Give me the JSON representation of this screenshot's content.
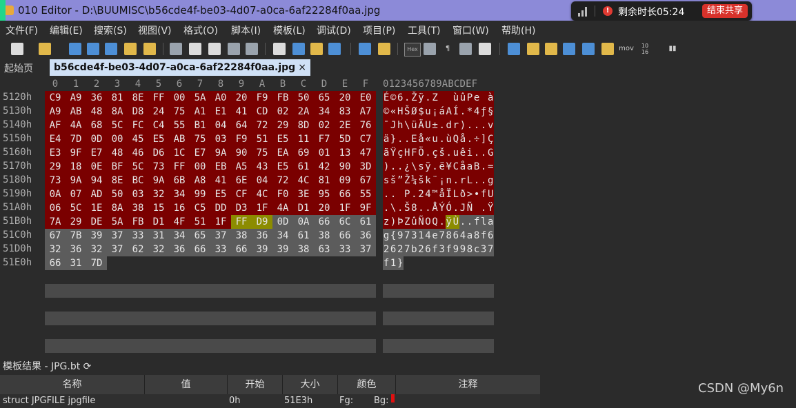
{
  "window": {
    "title": "010 Editor - D:\\BUUMISC\\b56cde4f-be03-4d07-a0ca-6af22284f0aa.jpg"
  },
  "share_widget": {
    "remaining": "剩余时长05:24",
    "end_button": "结束共享"
  },
  "menu": [
    "文件(F)",
    "编辑(E)",
    "搜索(S)",
    "视图(V)",
    "格式(O)",
    "脚本(I)",
    "模板(L)",
    "调试(D)",
    "项目(P)",
    "工具(T)",
    "窗口(W)",
    "帮助(H)"
  ],
  "toolbar": {
    "hex_label": "Hex",
    "mov_label": "mov",
    "base_label": "10 16"
  },
  "tabs": {
    "start": "起始页",
    "file": "b56cde4f-be03-4d07-a0ca-6af22284f0aa.jpg",
    "close": "×"
  },
  "hex": {
    "columns": [
      "0",
      "1",
      "2",
      "3",
      "4",
      "5",
      "6",
      "7",
      "8",
      "9",
      "A",
      "B",
      "C",
      "D",
      "E",
      "F"
    ],
    "ascii_header": "0123456789ABCDEF",
    "rows": [
      {
        "addr": "5120h",
        "bytes": [
          "C9",
          "A9",
          "36",
          "81",
          "8E",
          "FF",
          "00",
          "5A",
          "A0",
          "20",
          "F9",
          "FB",
          "50",
          "65",
          "20",
          "E0"
        ],
        "ascii": "É©6.Žÿ.Z  ùûPe à"
      },
      {
        "addr": "5130h",
        "bytes": [
          "A9",
          "AB",
          "48",
          "8A",
          "D8",
          "24",
          "75",
          "A1",
          "E1",
          "41",
          "CD",
          "02",
          "2A",
          "34",
          "83",
          "A7"
        ],
        "ascii": "©«HŠØ$u¡áAÍ.*4ƒ§"
      },
      {
        "addr": "5140h",
        "bytes": [
          "AF",
          "4A",
          "68",
          "5C",
          "FC",
          "C4",
          "55",
          "B1",
          "04",
          "64",
          "72",
          "29",
          "8D",
          "02",
          "2E",
          "76"
        ],
        "ascii": "¯Jh\\üÄU±.dr)...v"
      },
      {
        "addr": "5150h",
        "bytes": [
          "E4",
          "7D",
          "0D",
          "00",
          "45",
          "E5",
          "AB",
          "75",
          "03",
          "F9",
          "51",
          "E5",
          "11",
          "F7",
          "5D",
          "C7"
        ],
        "ascii": "ä}..Eå«u.ùQå.÷]Ç"
      },
      {
        "addr": "5160h",
        "bytes": [
          "E3",
          "9F",
          "E7",
          "48",
          "46",
          "D6",
          "1C",
          "E7",
          "9A",
          "90",
          "75",
          "EA",
          "69",
          "01",
          "13",
          "47"
        ],
        "ascii": "ãŸçHFÖ.çš.uêi..G"
      },
      {
        "addr": "5170h",
        "bytes": [
          "29",
          "18",
          "0E",
          "BF",
          "5C",
          "73",
          "FF",
          "00",
          "EB",
          "A5",
          "43",
          "E5",
          "61",
          "42",
          "90",
          "3D"
        ],
        "ascii": ")..¿\\sÿ.ë¥CåaB.="
      },
      {
        "addr": "5180h",
        "bytes": [
          "73",
          "9A",
          "94",
          "8E",
          "BC",
          "9A",
          "6B",
          "A8",
          "41",
          "6E",
          "04",
          "72",
          "4C",
          "81",
          "09",
          "67"
        ],
        "ascii": "sš”Ž¼šk¨¡n.rL..g"
      },
      {
        "addr": "5190h",
        "bytes": [
          "0A",
          "07",
          "AD",
          "50",
          "03",
          "32",
          "34",
          "99",
          "E5",
          "CF",
          "4C",
          "F0",
          "3E",
          "95",
          "66",
          "55"
        ],
        "ascii": "..­P.24™åÏLð>•fU"
      },
      {
        "addr": "51A0h",
        "bytes": [
          "06",
          "5C",
          "1E",
          "8A",
          "38",
          "15",
          "16",
          "C5",
          "DD",
          "D3",
          "1F",
          "4A",
          "D1",
          "20",
          "1F",
          "9F"
        ],
        "ascii": ".\\.Š8..ÅÝÓ.JÑ .Ÿ"
      },
      {
        "addr": "51B0h",
        "bytes": [
          "7A",
          "29",
          "DE",
          "5A",
          "FB",
          "D1",
          "4F",
          "51",
          "1F",
          "FF",
          "D9",
          "0D",
          "0A",
          "66",
          "6C",
          "61"
        ],
        "ascii": "z)ÞZûÑOQ.ÿÙ..fla"
      },
      {
        "addr": "51C0h",
        "bytes": [
          "67",
          "7B",
          "39",
          "37",
          "33",
          "31",
          "34",
          "65",
          "37",
          "38",
          "36",
          "34",
          "61",
          "38",
          "66",
          "36"
        ],
        "ascii": "g{97314e7864a8f6"
      },
      {
        "addr": "51D0h",
        "bytes": [
          "32",
          "36",
          "32",
          "37",
          "62",
          "32",
          "36",
          "66",
          "33",
          "66",
          "39",
          "39",
          "38",
          "63",
          "33",
          "37"
        ],
        "ascii": "2627b26f3f998c37"
      },
      {
        "addr": "51E0h",
        "bytes": [
          "66",
          "31",
          "7D"
        ],
        "ascii": "f1}"
      }
    ],
    "colors": {
      "red_region": "#7a0000",
      "eoi_marker": "#8c8c00",
      "flag_region": "#5c5c5c"
    }
  },
  "template": {
    "title": "模板结果 - JPG.bt",
    "refresh_icon": "refresh-icon",
    "headers": [
      "名称",
      "值",
      "开始",
      "大小",
      "颜色",
      "注释"
    ],
    "row": {
      "name": "struct JPGFILE jpgfile",
      "value": "",
      "start": "0h",
      "size": "51E3h",
      "fg": "Fg:",
      "bg": "Bg:"
    }
  },
  "watermark": "CSDN @My6n"
}
